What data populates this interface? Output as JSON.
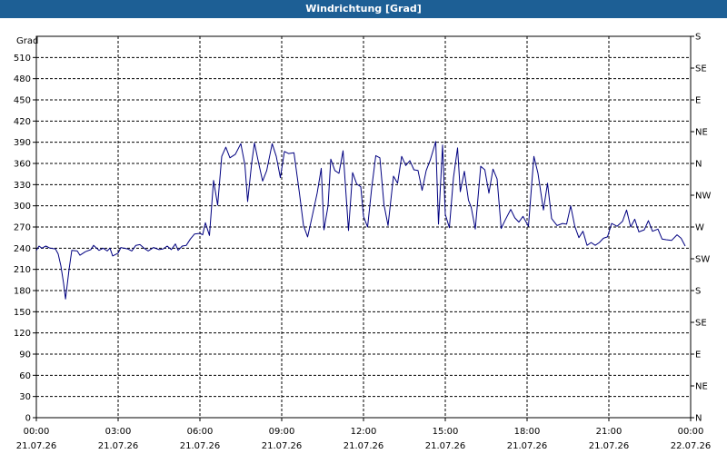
{
  "window": {
    "title": "Windrichtung [Grad]"
  },
  "chart_data": {
    "type": "line",
    "title": "Windrichtung [Grad]",
    "ylabel": "Grad",
    "ylim": [
      0,
      540
    ],
    "yticks": [
      0,
      30,
      60,
      90,
      120,
      150,
      180,
      210,
      240,
      270,
      300,
      330,
      360,
      390,
      420,
      450,
      480,
      510
    ],
    "y2_labels": [
      {
        "value": 0,
        "label": "N"
      },
      {
        "value": 45,
        "label": "NE"
      },
      {
        "value": 90,
        "label": "E"
      },
      {
        "value": 135,
        "label": "SE"
      },
      {
        "value": 180,
        "label": "S"
      },
      {
        "value": 225,
        "label": "SW"
      },
      {
        "value": 270,
        "label": "W"
      },
      {
        "value": 315,
        "label": "NW"
      },
      {
        "value": 360,
        "label": "N"
      },
      {
        "value": 405,
        "label": "NE"
      },
      {
        "value": 450,
        "label": "E"
      },
      {
        "value": 495,
        "label": "SE"
      },
      {
        "value": 540,
        "label": "S"
      }
    ],
    "xlim": [
      0,
      24
    ],
    "x_ticks": [
      {
        "hour": 0,
        "time": "00:00",
        "date": "21.07.26"
      },
      {
        "hour": 3,
        "time": "03:00",
        "date": "21.07.26"
      },
      {
        "hour": 6,
        "time": "06:00",
        "date": "21.07.26"
      },
      {
        "hour": 9,
        "time": "09:00",
        "date": "21.07.26"
      },
      {
        "hour": 12,
        "time": "12:00",
        "date": "21.07.26"
      },
      {
        "hour": 15,
        "time": "15:00",
        "date": "21.07.26"
      },
      {
        "hour": 18,
        "time": "18:00",
        "date": "21.07.26"
      },
      {
        "hour": 21,
        "time": "21:00",
        "date": "21.07.26"
      },
      {
        "hour": 24,
        "time": "00:00",
        "date": "22.07.26"
      }
    ],
    "grid": true,
    "series": [
      {
        "color": "#000080",
        "points": [
          [
            0.0,
            237
          ],
          [
            0.1,
            243
          ],
          [
            0.2,
            240
          ],
          [
            0.35,
            243
          ],
          [
            0.5,
            240
          ],
          [
            0.7,
            239
          ],
          [
            0.8,
            232
          ],
          [
            0.9,
            215
          ],
          [
            1.0,
            190
          ],
          [
            1.07,
            168
          ],
          [
            1.2,
            210
          ],
          [
            1.3,
            237
          ],
          [
            1.5,
            236
          ],
          [
            1.6,
            230
          ],
          [
            1.8,
            235
          ],
          [
            2.0,
            238
          ],
          [
            2.1,
            244
          ],
          [
            2.3,
            237
          ],
          [
            2.45,
            240
          ],
          [
            2.6,
            236
          ],
          [
            2.7,
            240
          ],
          [
            2.8,
            229
          ],
          [
            3.0,
            233
          ],
          [
            3.1,
            241
          ],
          [
            3.2,
            240
          ],
          [
            3.35,
            239
          ],
          [
            3.5,
            236
          ],
          [
            3.65,
            244
          ],
          [
            3.8,
            245
          ],
          [
            3.95,
            240
          ],
          [
            4.1,
            236
          ],
          [
            4.3,
            241
          ],
          [
            4.5,
            238
          ],
          [
            4.65,
            239
          ],
          [
            4.8,
            243
          ],
          [
            4.95,
            238
          ],
          [
            5.1,
            246
          ],
          [
            5.2,
            237
          ],
          [
            5.35,
            243
          ],
          [
            5.5,
            244
          ],
          [
            5.65,
            253
          ],
          [
            5.8,
            260
          ],
          [
            6.0,
            261
          ],
          [
            6.1,
            259
          ],
          [
            6.2,
            276
          ],
          [
            6.35,
            258
          ],
          [
            6.5,
            336
          ],
          [
            6.65,
            301
          ],
          [
            6.8,
            370
          ],
          [
            6.95,
            383
          ],
          [
            7.1,
            368
          ],
          [
            7.3,
            373
          ],
          [
            7.5,
            388
          ],
          [
            7.65,
            358
          ],
          [
            7.75,
            306
          ],
          [
            7.9,
            361
          ],
          [
            8.0,
            389
          ],
          [
            8.15,
            361
          ],
          [
            8.3,
            335
          ],
          [
            8.45,
            350
          ],
          [
            8.65,
            388
          ],
          [
            8.8,
            370
          ],
          [
            8.95,
            340
          ],
          [
            9.1,
            377
          ],
          [
            9.25,
            374
          ],
          [
            9.45,
            375
          ],
          [
            9.65,
            318
          ],
          [
            9.8,
            272
          ],
          [
            9.95,
            256
          ],
          [
            10.1,
            282
          ],
          [
            10.3,
            318
          ],
          [
            10.45,
            353
          ],
          [
            10.55,
            266
          ],
          [
            10.7,
            300
          ],
          [
            10.8,
            366
          ],
          [
            10.95,
            350
          ],
          [
            11.1,
            346
          ],
          [
            11.25,
            378
          ],
          [
            11.45,
            265
          ],
          [
            11.6,
            347
          ],
          [
            11.75,
            331
          ],
          [
            11.9,
            327
          ],
          [
            12.0,
            285
          ],
          [
            12.15,
            270
          ],
          [
            12.3,
            325
          ],
          [
            12.45,
            371
          ],
          [
            12.6,
            368
          ],
          [
            12.75,
            302
          ],
          [
            12.9,
            272
          ],
          [
            13.1,
            342
          ],
          [
            13.25,
            332
          ],
          [
            13.4,
            370
          ],
          [
            13.55,
            357
          ],
          [
            13.7,
            364
          ],
          [
            13.85,
            351
          ],
          [
            14.0,
            350
          ],
          [
            14.15,
            322
          ],
          [
            14.3,
            350
          ],
          [
            14.45,
            365
          ],
          [
            14.65,
            391
          ],
          [
            14.75,
            274
          ],
          [
            14.9,
            386
          ],
          [
            15.0,
            288
          ],
          [
            15.15,
            269
          ],
          [
            15.3,
            340
          ],
          [
            15.45,
            382
          ],
          [
            15.55,
            320
          ],
          [
            15.7,
            349
          ],
          [
            15.85,
            308
          ],
          [
            15.95,
            298
          ],
          [
            16.1,
            267
          ],
          [
            16.3,
            356
          ],
          [
            16.45,
            351
          ],
          [
            16.6,
            318
          ],
          [
            16.75,
            352
          ],
          [
            16.9,
            338
          ],
          [
            17.05,
            268
          ],
          [
            17.2,
            280
          ],
          [
            17.4,
            295
          ],
          [
            17.55,
            283
          ],
          [
            17.7,
            277
          ],
          [
            17.85,
            285
          ],
          [
            18.05,
            271
          ],
          [
            18.25,
            370
          ],
          [
            18.4,
            346
          ],
          [
            18.6,
            294
          ],
          [
            18.75,
            332
          ],
          [
            18.9,
            282
          ],
          [
            19.1,
            272
          ],
          [
            19.3,
            275
          ],
          [
            19.45,
            274
          ],
          [
            19.6,
            300
          ],
          [
            19.75,
            271
          ],
          [
            19.9,
            255
          ],
          [
            20.05,
            264
          ],
          [
            20.2,
            244
          ],
          [
            20.35,
            248
          ],
          [
            20.5,
            244
          ],
          [
            20.65,
            248
          ],
          [
            20.8,
            254
          ],
          [
            20.95,
            256
          ],
          [
            21.1,
            275
          ],
          [
            21.3,
            271
          ],
          [
            21.5,
            278
          ],
          [
            21.65,
            294
          ],
          [
            21.8,
            270
          ],
          [
            21.95,
            281
          ],
          [
            22.1,
            263
          ],
          [
            22.3,
            266
          ],
          [
            22.45,
            279
          ],
          [
            22.6,
            264
          ],
          [
            22.8,
            267
          ],
          [
            22.95,
            253
          ],
          [
            23.1,
            252
          ],
          [
            23.3,
            251
          ],
          [
            23.5,
            259
          ],
          [
            23.65,
            254
          ],
          [
            23.8,
            243
          ]
        ]
      }
    ]
  }
}
